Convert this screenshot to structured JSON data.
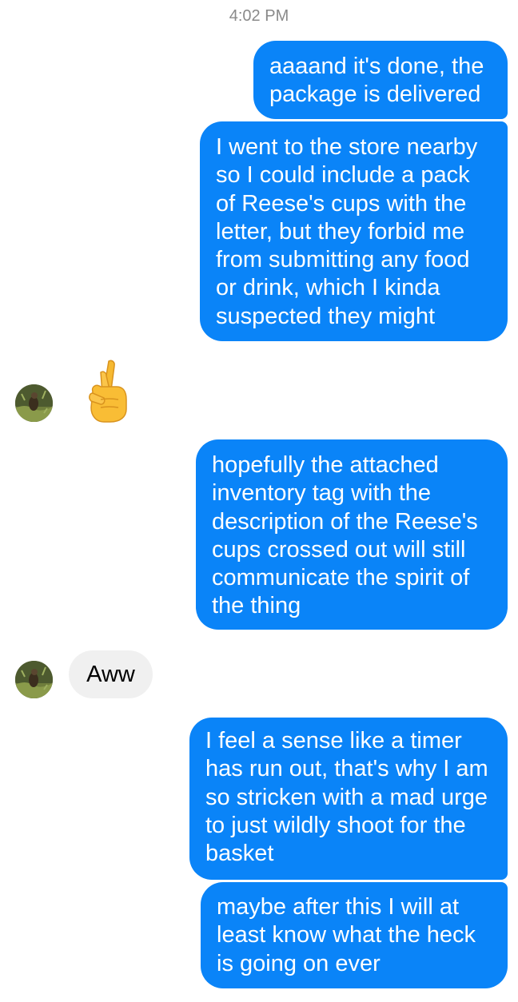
{
  "timestamp": "4:02 PM",
  "messages": [
    {
      "sender": "me",
      "text": "aaaand it's done, the package is delivered"
    },
    {
      "sender": "me",
      "text": "I went to the store nearby so I could include a pack of Reese's cups with the letter, but they forbid me from submitting any food or drink, which I kinda suspected they might"
    },
    {
      "sender": "them",
      "reaction": "crossed-fingers-emoji"
    },
    {
      "sender": "me",
      "text": "hopefully the attached inventory tag with the description of the Reese's cups crossed out will still communicate the spirit of the thing"
    },
    {
      "sender": "them",
      "text": "Aww"
    },
    {
      "sender": "me",
      "text": "I feel a sense like a timer has run out, that's why I am so stricken with a mad urge to just wildly shoot for the basket"
    },
    {
      "sender": "me",
      "text": "maybe after this I will at least know what the heck is going on ever"
    }
  ],
  "colors": {
    "outgoing_bubble": "#0a84f8",
    "incoming_bubble": "#f0f0f0",
    "timestamp": "#8a8a8a"
  }
}
